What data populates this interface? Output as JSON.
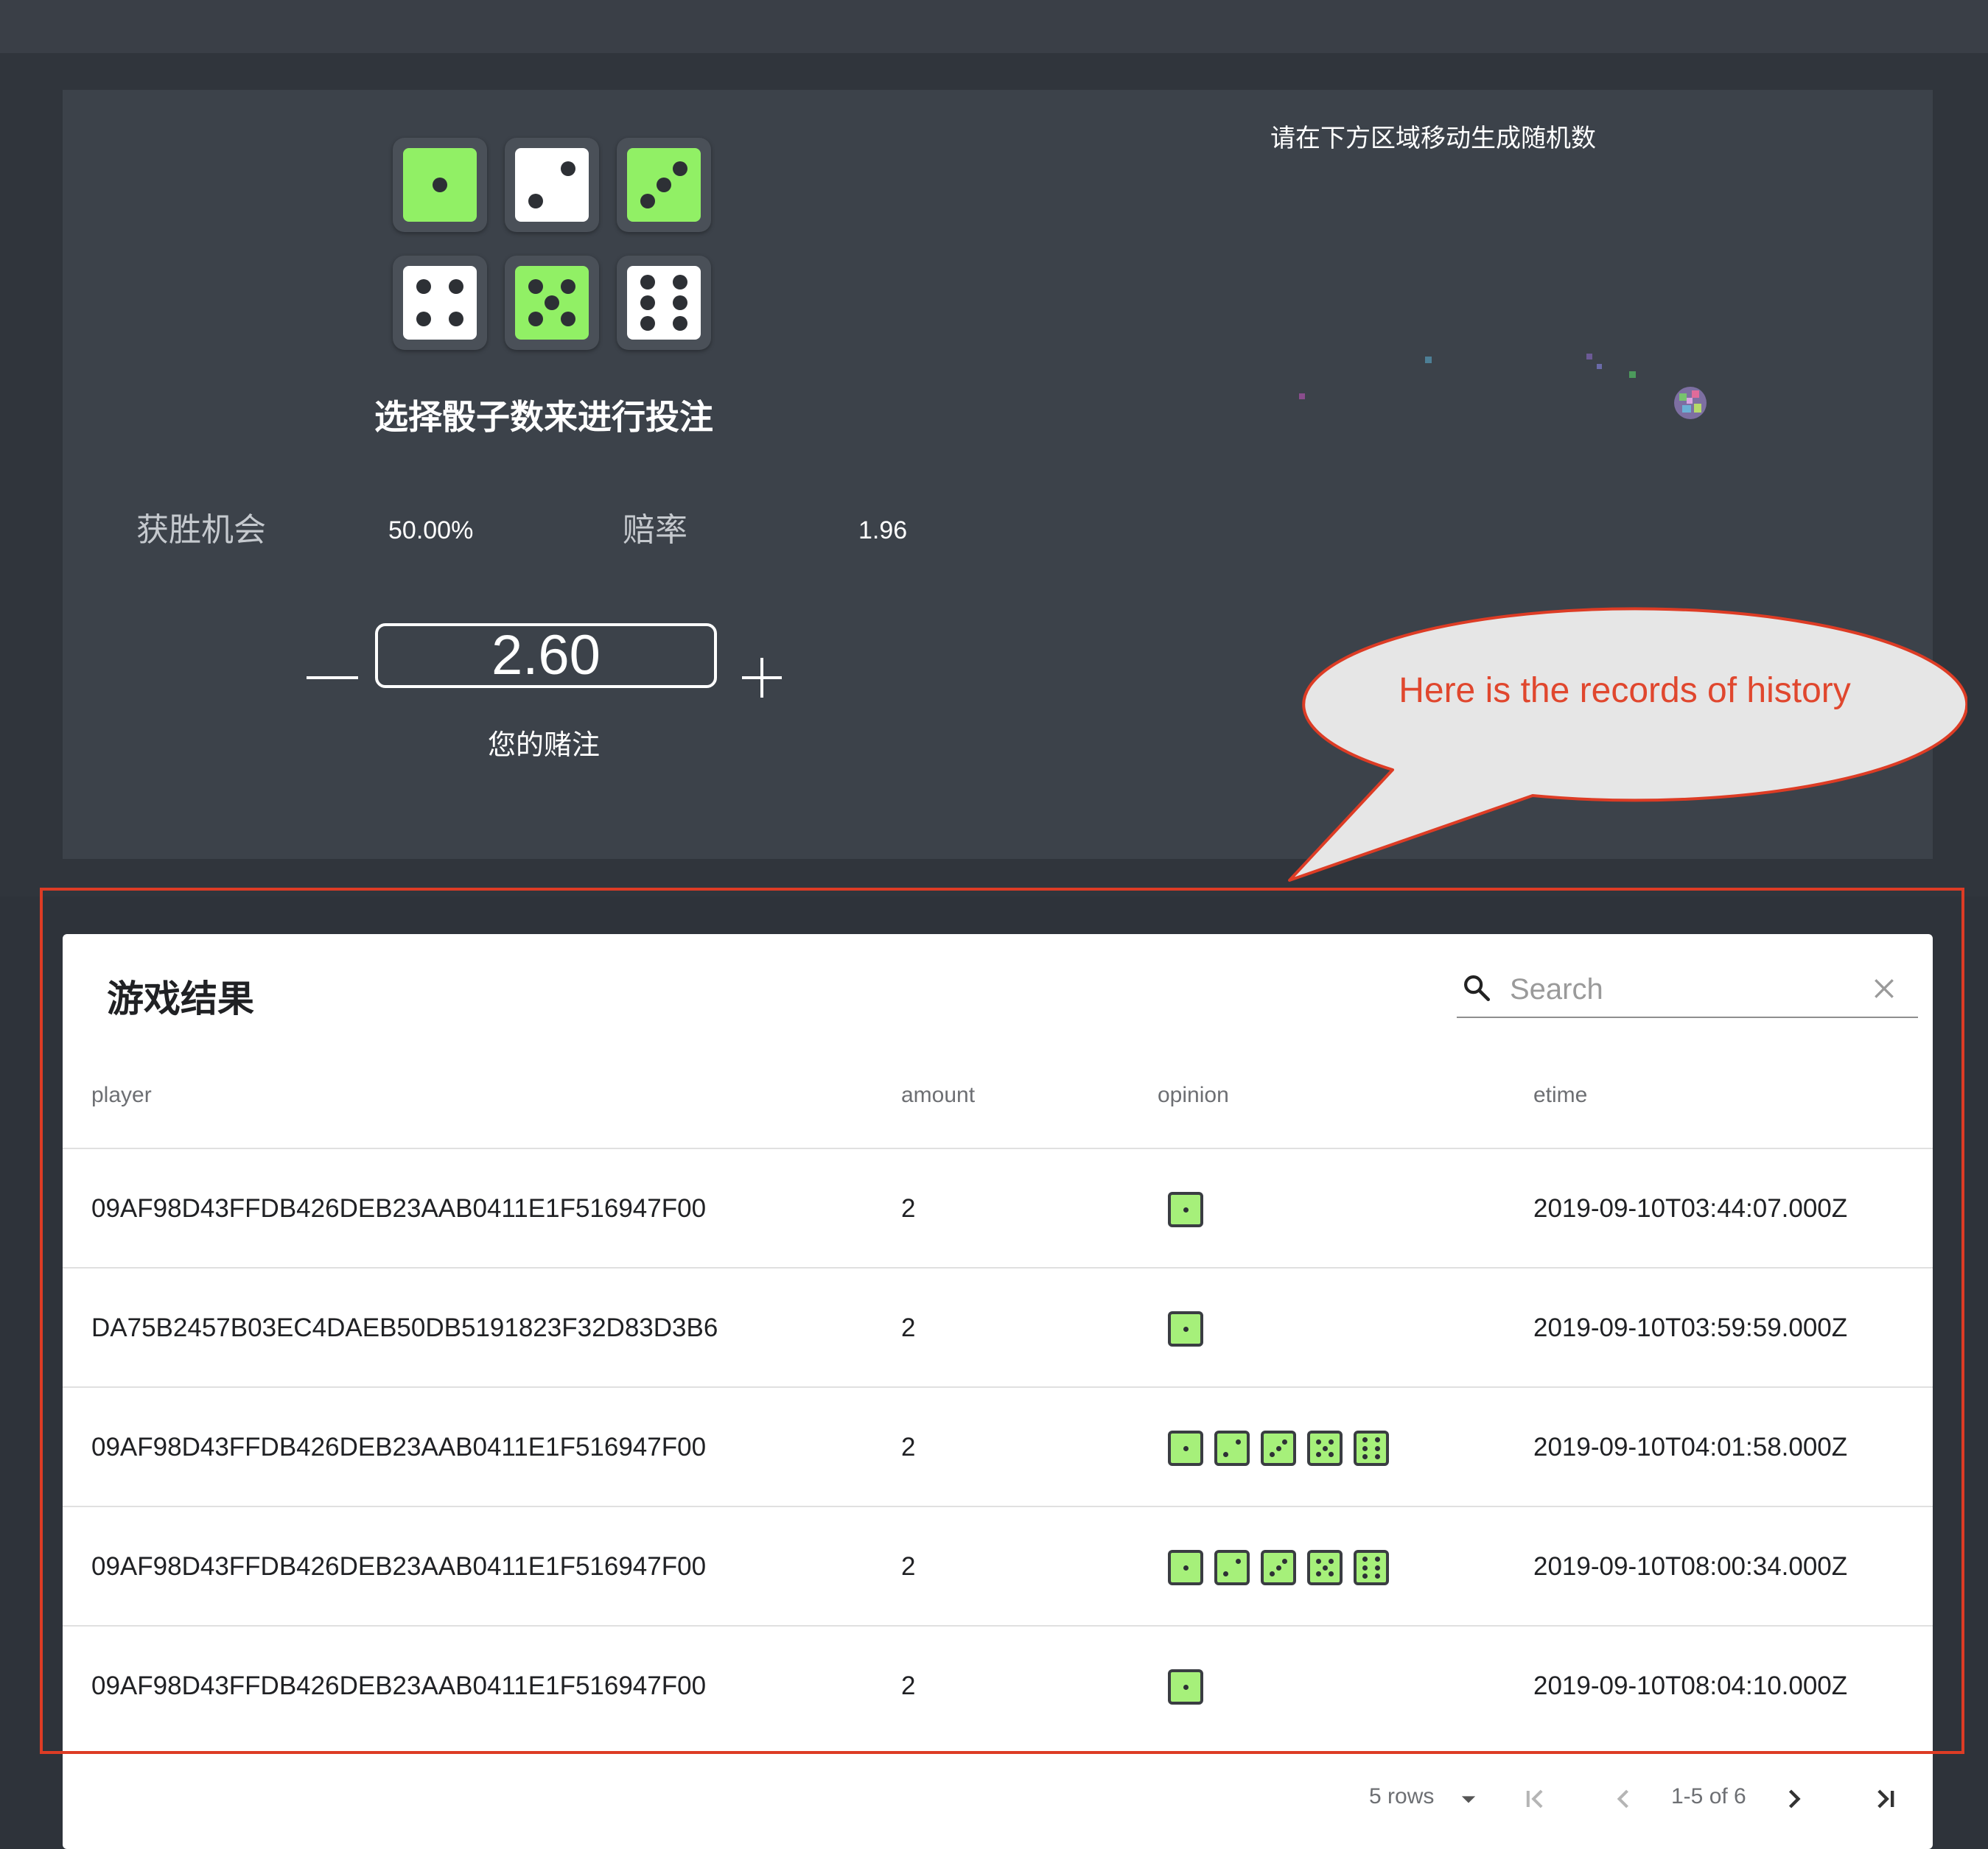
{
  "game": {
    "title": "选择骰子数来进行投注",
    "dice": [
      {
        "face": 1,
        "selected": true
      },
      {
        "face": 2,
        "selected": false
      },
      {
        "face": 3,
        "selected": true
      },
      {
        "face": 4,
        "selected": false
      },
      {
        "face": 5,
        "selected": true
      },
      {
        "face": 6,
        "selected": false
      }
    ],
    "win_chance_label": "获胜机会",
    "win_chance_value": "50.00%",
    "odds_label": "赔率",
    "odds_value": "1.96",
    "bet_value": "2.60",
    "bet_caption": "您的赌注",
    "rng_hint": "请在下方区域移动生成随机数"
  },
  "callout": {
    "text": "Here is the records of history"
  },
  "results": {
    "title": "游戏结果",
    "search_placeholder": "Search",
    "columns": [
      "player",
      "amount",
      "opinion",
      "etime"
    ],
    "rows": [
      {
        "player": "09AF98D43FFDB426DEB23AAB0411E1F516947F00",
        "amount": "2",
        "opinion": [
          1
        ],
        "etime": "2019-09-10T03:44:07.000Z"
      },
      {
        "player": "DA75B2457B03EC4DAEB50DB5191823F32D83D3B6",
        "amount": "2",
        "opinion": [
          1
        ],
        "etime": "2019-09-10T03:59:59.000Z"
      },
      {
        "player": "09AF98D43FFDB426DEB23AAB0411E1F516947F00",
        "amount": "2",
        "opinion": [
          1,
          2,
          3,
          5,
          6
        ],
        "etime": "2019-09-10T04:01:58.000Z"
      },
      {
        "player": "09AF98D43FFDB426DEB23AAB0411E1F516947F00",
        "amount": "2",
        "opinion": [
          1,
          2,
          3,
          5,
          6
        ],
        "etime": "2019-09-10T08:00:34.000Z"
      },
      {
        "player": "09AF98D43FFDB426DEB23AAB0411E1F516947F00",
        "amount": "2",
        "opinion": [
          1
        ],
        "etime": "2019-09-10T08:04:10.000Z"
      }
    ],
    "pagination": {
      "rows_per_page": "5 rows",
      "range": "1-5 of 6"
    }
  },
  "colors": {
    "die_selected": "#91f065",
    "die_unselected": "#ffffff",
    "callout_red": "#e0472e",
    "panel_bg": "#3c424a"
  }
}
